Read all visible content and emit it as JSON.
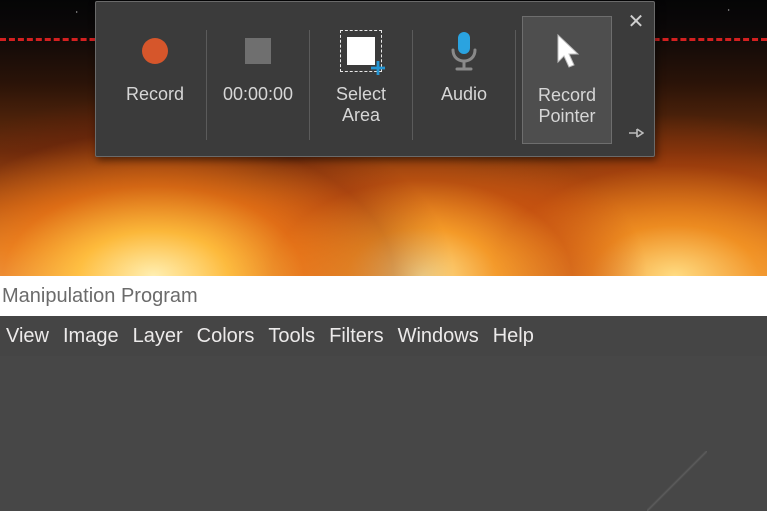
{
  "toolbar": {
    "record_label": "Record",
    "timer_value": "00:00:00",
    "select_area_label": "Select\nArea",
    "audio_label": "Audio",
    "record_pointer_label": "Record\nPointer",
    "close_title": "Close",
    "pin_title": "Pin",
    "colors": {
      "record_dot": "#d6562b",
      "mic": "#2aa3e0"
    }
  },
  "gimp": {
    "title_fragment": " Manipulation Program",
    "menu": [
      "View",
      "Image",
      "Layer",
      "Colors",
      "Tools",
      "Filters",
      "Windows",
      "Help"
    ]
  }
}
